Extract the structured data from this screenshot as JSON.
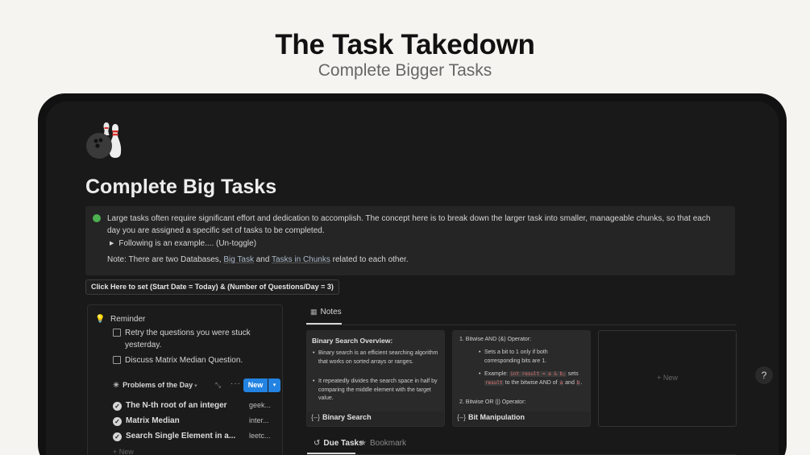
{
  "hero": {
    "title": "The Task Takedown",
    "subtitle": "Complete Bigger Tasks"
  },
  "page": {
    "icon": "bowling-icon",
    "title": "Complete Big Tasks"
  },
  "callout": {
    "text": "Large tasks often require significant effort and dedication to accomplish. The concept here is to break down the larger task into smaller, manageable chunks, so that each day you are assigned a specific set of tasks to be completed.",
    "toggle_label": "Following is an example.... (Un-toggle)",
    "note_prefix": "Note: There are two Databases,",
    "note_link1": "Big Task",
    "note_and": "and",
    "note_link2": "Tasks in Chunks",
    "note_suffix": "related to each other.",
    "accent_color": "#4caf50"
  },
  "set_button": "Click Here to set (Start Date = Today) & (Number of Questions/Day = 3)",
  "reminder": {
    "title": "Reminder",
    "todos": [
      "Retry the questions you were stuck yesterday.",
      "Discuss Matrix Median Question."
    ]
  },
  "problems": {
    "view_label": "Problems of the Day",
    "new_label": "New",
    "rows": [
      {
        "name": "The N-th root of an integer",
        "site": "geek..."
      },
      {
        "name": "Matrix Median",
        "site": "inter..."
      },
      {
        "name": "Search Single Element in a...",
        "site": "leetc..."
      }
    ],
    "add_label": "+ New"
  },
  "notes": {
    "tab_label": "Notes",
    "cards": [
      {
        "heading": "Binary Search Overview:",
        "bullets": [
          "Binary search is an efficient searching algorithm that works on sorted arrays or ranges.",
          "It repeatedly divides the search space in half by comparing the middle element with the target value."
        ],
        "footer": "Binary Search"
      },
      {
        "item1": "1.   Bitwise AND (&) Operator:",
        "bullet1": "Sets a bit to 1 only if both corresponding bits are 1.",
        "example_prefix": "Example:",
        "code1": "int result = a & b;",
        "example_mid": "sets",
        "code2": "result",
        "example_mid2": "to the bitwise AND of",
        "code3": "a",
        "example_and": "and",
        "code4": "b",
        "example_end": ".",
        "item2": "2.   Bitwise OR (|) Operator:",
        "footer": "Bit Manipulation"
      }
    ],
    "new_card_label": "+ New"
  },
  "bottom_tabs": {
    "due": "Due Tasks",
    "bookmark": "Bookmark"
  },
  "help": "?"
}
